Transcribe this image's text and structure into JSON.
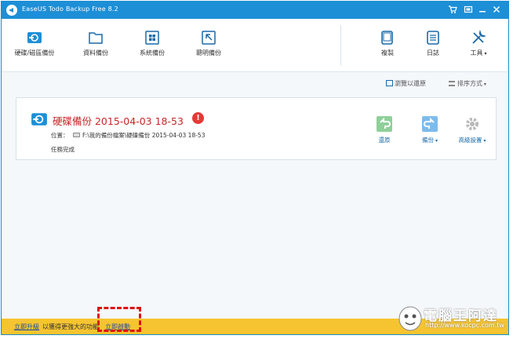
{
  "window": {
    "title": "EaseUS Todo Backup Free 8.2"
  },
  "titlebar_icons": [
    "cart-icon",
    "restore-window-icon",
    "minimize-icon",
    "close-icon"
  ],
  "toolbar": {
    "items": [
      {
        "label": "硬碟/磁區備份",
        "icon": "disk-backup-icon"
      },
      {
        "label": "資料備份",
        "icon": "folder-icon"
      },
      {
        "label": "系統備份",
        "icon": "windows-icon"
      },
      {
        "label": "聰明備份",
        "icon": "smart-cursor-icon"
      }
    ],
    "right_items": [
      {
        "label": "複製",
        "icon": "clone-icon"
      },
      {
        "label": "日誌",
        "icon": "log-icon"
      },
      {
        "label": "工具",
        "icon": "tools-icon",
        "has_dropdown": true
      }
    ]
  },
  "toolbar2": {
    "browse_label": "瀏覽以還原",
    "sort_label": "排序方式"
  },
  "backup_card": {
    "title": "硬碟備份 2015-04-03 18-53",
    "alert_symbol": "!",
    "location_label": "位置：",
    "location_value": "F:\\我的備份檔案\\硬碟備份 2015-04-03 18-53",
    "status": "任務完成",
    "actions": [
      {
        "label": "還原",
        "icon": "restore-icon"
      },
      {
        "label": "備份",
        "icon": "backup-icon",
        "has_dropdown": true
      },
      {
        "label": "高級設置",
        "icon": "gear-icon",
        "has_dropdown": true
      }
    ]
  },
  "statusbar": {
    "upgrade_link": "立即升級",
    "upgrade_text": "以獲得更強大的功能",
    "activate_link": "立即啟動"
  },
  "watermark": {
    "text": "電腦王阿達",
    "url": "http://www.kocpc.com.tw"
  },
  "colors": {
    "titlebar": "#1d8fd7",
    "statusbar": "#f6c430",
    "title_red": "#c62828",
    "action_green": "#6cbf7a",
    "action_blue": "#4aa3df"
  }
}
